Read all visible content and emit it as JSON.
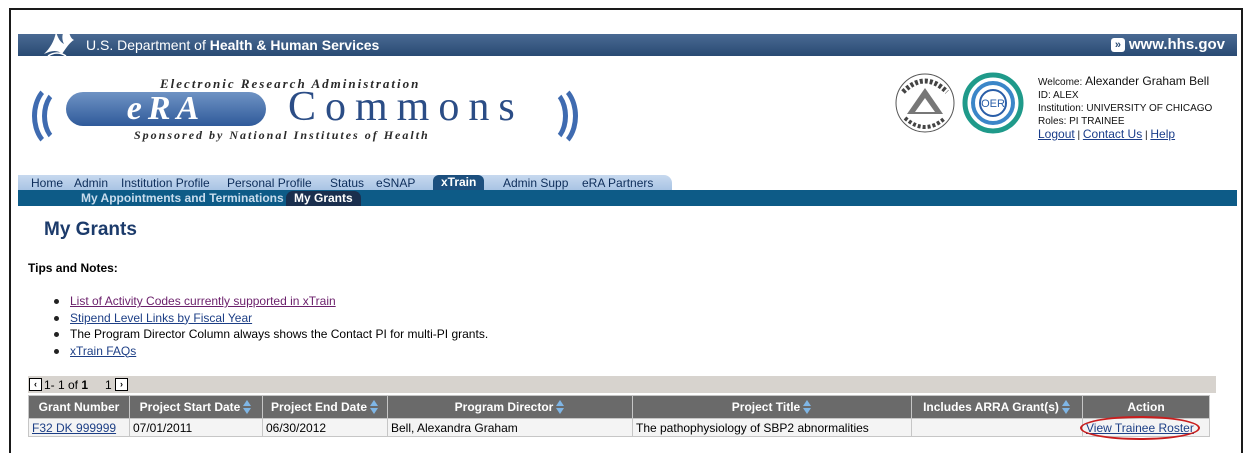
{
  "hhs": {
    "prefix": "U.S. Department of ",
    "bold": "Health & Human Services",
    "url": "www.hhs.gov"
  },
  "logo": {
    "top_line": "Electronic Research Administration",
    "era": "eRA",
    "commons": "Commons",
    "bottom_line": "Sponsored by National Institutes of Health"
  },
  "seals": {
    "nih": "NATIONAL INSTITUTES OF HEALTH",
    "oer": "OER"
  },
  "user": {
    "welcome_label": "Welcome: ",
    "welcome_name": "Alexander Graham Bell",
    "id": "ID: ALEX",
    "institution": "Institution: UNIVERSITY OF CHICAGO",
    "roles": "Roles:  PI TRAINEE",
    "logout": "Logout",
    "contact": "Contact Us",
    "help": "Help",
    "sep": " | "
  },
  "tabs": [
    {
      "label": "Home"
    },
    {
      "label": "Admin"
    },
    {
      "label": "Institution Profile"
    },
    {
      "label": "Personal Profile"
    },
    {
      "label": "Status"
    },
    {
      "label": "eSNAP"
    },
    {
      "label": "xTrain"
    },
    {
      "label": "Admin Supp"
    },
    {
      "label": "eRA Partners"
    }
  ],
  "subtabs": [
    {
      "label": "My Appointments and Terminations"
    },
    {
      "label": "My Grants"
    }
  ],
  "page_title": "My Grants",
  "tips_heading": "Tips and Notes:",
  "notes": [
    "List of Activity Codes currently supported in xTrain",
    "Stipend Level Links by Fiscal Year",
    "The Program Director Column always shows the Contact PI for multi-PI grants.",
    "xTrain FAQs"
  ],
  "pager": {
    "range": "1- 1 of ",
    "total": "1",
    "page": "1"
  },
  "table": {
    "headers": [
      "Grant Number",
      "Project Start Date",
      "Project End Date",
      "Program Director",
      "Project Title",
      "Includes ARRA Grant(s)",
      "Action"
    ],
    "rows": [
      {
        "grant_number": "F32 DK  999999",
        "start": "07/01/2011",
        "end": "06/30/2012",
        "director": "Bell, Alexandra Graham",
        "title": "The pathophysiology of SBP2 abnormalities",
        "arra": "",
        "action": "View Trainee Roster"
      }
    ]
  },
  "colors": {
    "hhs_bar": "#294a73",
    "nav_bar": "#0d5b87",
    "active_tab": "#1c4f7e",
    "header_gray": "#6a6a6a",
    "highlight_circle": "#c81e1e"
  }
}
